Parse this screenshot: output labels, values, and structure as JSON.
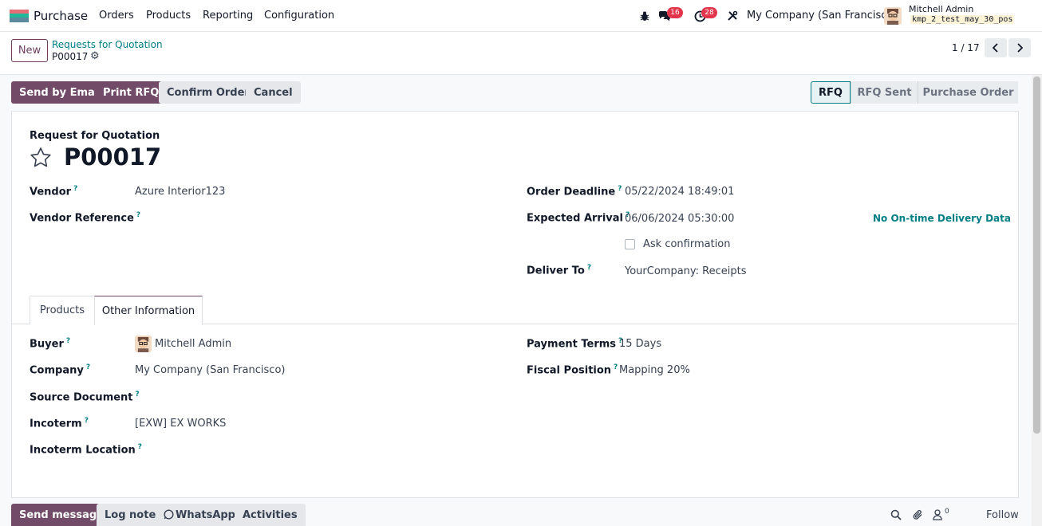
{
  "navbar": {
    "app_name": "Purchase",
    "menu": [
      "Orders",
      "Products",
      "Reporting",
      "Configuration"
    ],
    "chat_count": "16",
    "activity_count": "28",
    "company": "My Company (San Francisco)",
    "user_name": "Mitchell Admin",
    "db_name": "kmp_2_test_may_30_pos"
  },
  "control": {
    "new_label": "New",
    "breadcrumb_parent": "Requests for Quotation",
    "breadcrumb_current": "P00017",
    "pager": "1 / 17"
  },
  "actions": {
    "send_email": "Send by Email",
    "print_rfq": "Print RFQ",
    "confirm_order": "Confirm Order",
    "cancel": "Cancel"
  },
  "status": {
    "steps": [
      "RFQ",
      "RFQ Sent",
      "Purchase Order"
    ],
    "active": "RFQ"
  },
  "form": {
    "type_label": "Request for Quotation",
    "name": "P00017",
    "vendor_label": "Vendor",
    "vendor": "Azure Interior123",
    "vendor_ref_label": "Vendor Reference",
    "deadline_label": "Order Deadline",
    "deadline": "05/22/2024 18:49:01",
    "arrival_label": "Expected Arrival",
    "arrival": "06/06/2024 05:30:00",
    "delivery_data": "No On-time Delivery Data",
    "ask_confirmation": "Ask confirmation",
    "deliver_to_label": "Deliver To",
    "deliver_to": "YourCompany: Receipts"
  },
  "tabs": {
    "products": "Products",
    "other_info": "Other Information"
  },
  "other_info": {
    "buyer_label": "Buyer",
    "buyer": "Mitchell Admin",
    "company_label": "Company",
    "company": "My Company (San Francisco)",
    "source_label": "Source Document",
    "incoterm_label": "Incoterm",
    "incoterm": "[EXW] EX WORKS",
    "incoterm_location_label": "Incoterm Location",
    "payment_terms_label": "Payment Terms",
    "payment_terms": "15 Days",
    "fiscal_position_label": "Fiscal Position",
    "fiscal_position": "Mapping 20%"
  },
  "chatter": {
    "send_message": "Send message",
    "log_note": "Log note",
    "whatsapp": "WhatsApp",
    "activities": "Activities",
    "followers_count": "0",
    "follow": "Follow"
  },
  "help_mark": "?"
}
